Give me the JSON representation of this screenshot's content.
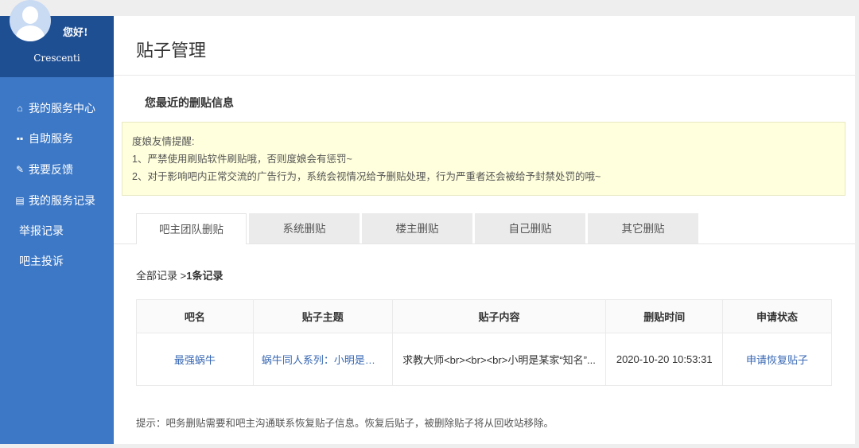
{
  "user": {
    "greeting": "您好!",
    "name": "Crescenti"
  },
  "sidebar": {
    "items": [
      {
        "label": "我的服务中心",
        "icon": "home-icon"
      },
      {
        "label": "自助服务",
        "icon": "grid-icon"
      },
      {
        "label": "我要反馈",
        "icon": "edit-icon"
      },
      {
        "label": "我的服务记录",
        "icon": "clipboard-icon"
      },
      {
        "label": "举报记录"
      },
      {
        "label": "吧主投诉"
      }
    ]
  },
  "page": {
    "title": "贴子管理",
    "subtitle": "您最近的删贴信息"
  },
  "notice": {
    "title": "度娘友情提醒:",
    "lines": [
      "1、严禁使用刷贴软件刷贴哦，否则度娘会有惩罚~",
      "2、对于影响吧内正常交流的广告行为，系统会视情况给予删贴处理，行为严重者还会被给予封禁处罚的哦~"
    ]
  },
  "tabs": [
    "吧主团队删贴",
    "系统删贴",
    "楼主删贴",
    "自己删贴",
    "其它删贴"
  ],
  "records": {
    "summary_prefix": "全部记录 >",
    "count": "1条记录"
  },
  "table": {
    "headers": [
      "吧名",
      "贴子主题",
      "贴子内容",
      "删贴时间",
      "申请状态"
    ],
    "rows": [
      [
        "最强蜗牛",
        "蜗牛同人系列：小明是个...",
        "求教大师<br><br><br>小明是某家“知名”...",
        "2020-10-20 10:53:31",
        "申请恢复贴子"
      ]
    ]
  },
  "footer_tip": "提示：吧务删贴需要和吧主沟通联系恢复贴子信息。恢复后贴子，被删除贴子将从回收站移除。"
}
